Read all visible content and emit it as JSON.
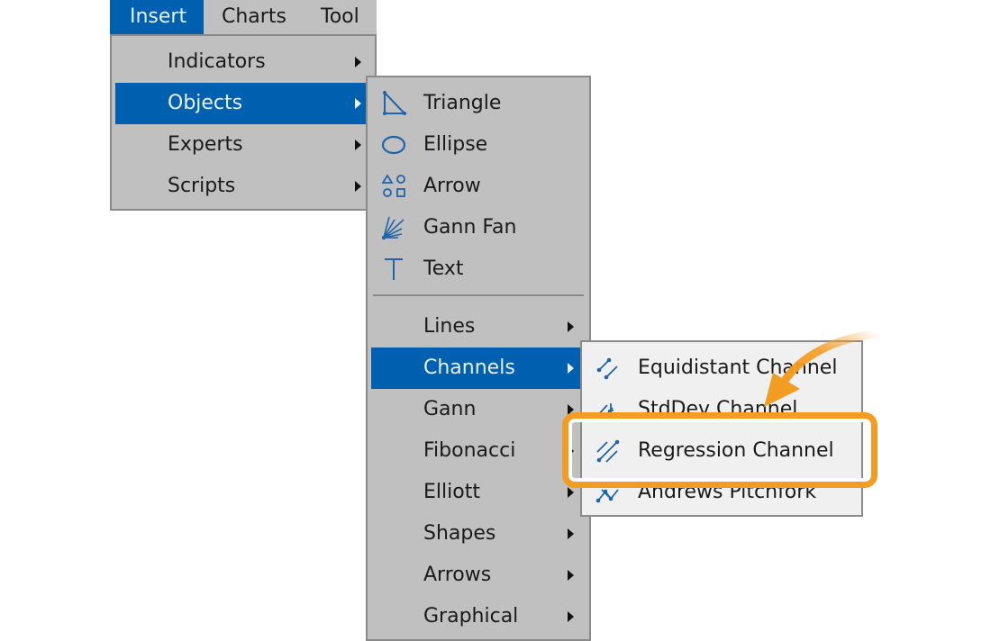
{
  "menubar": {
    "items": [
      {
        "label": "Insert",
        "active": true
      },
      {
        "label": "Charts",
        "active": false
      },
      {
        "label": "Tool",
        "active": false
      }
    ]
  },
  "insert_menu": {
    "items": [
      {
        "label": "Indicators",
        "submenu": true,
        "selected": false
      },
      {
        "label": "Objects",
        "submenu": true,
        "selected": true
      },
      {
        "label": "Experts",
        "submenu": true,
        "selected": false
      },
      {
        "label": "Scripts",
        "submenu": true,
        "selected": false
      }
    ]
  },
  "objects_menu": {
    "shapes": [
      {
        "label": "Triangle",
        "icon": "triangle-icon"
      },
      {
        "label": "Ellipse",
        "icon": "ellipse-icon"
      },
      {
        "label": "Arrow",
        "icon": "arrow-shapes-icon"
      },
      {
        "label": "Gann Fan",
        "icon": "gann-fan-icon"
      },
      {
        "label": "Text",
        "icon": "text-icon"
      }
    ],
    "groups": [
      {
        "label": "Lines",
        "submenu": true,
        "selected": false
      },
      {
        "label": "Channels",
        "submenu": true,
        "selected": true
      },
      {
        "label": "Gann",
        "submenu": true,
        "selected": false
      },
      {
        "label": "Fibonacci",
        "submenu": true,
        "selected": false
      },
      {
        "label": "Elliott",
        "submenu": true,
        "selected": false
      },
      {
        "label": "Shapes",
        "submenu": true,
        "selected": false
      },
      {
        "label": "Arrows",
        "submenu": true,
        "selected": false
      },
      {
        "label": "Graphical",
        "submenu": true,
        "selected": false
      }
    ]
  },
  "channels_menu": {
    "items": [
      {
        "label": "Equidistant Channel",
        "icon": "equidistant-channel-icon"
      },
      {
        "label": "StdDev Channel",
        "icon": "stddev-channel-icon"
      },
      {
        "label": "Regression Channel",
        "icon": "regression-channel-icon",
        "highlighted": true
      },
      {
        "label": "Andrews Pitchfork",
        "icon": "andrews-pitchfork-icon"
      }
    ]
  },
  "annotation": {
    "highlight_color": "#f39c23",
    "target": "Regression Channel"
  },
  "colors": {
    "selection": "#0060b0",
    "menu_bg": "#c0c0c0",
    "submenu_bg": "#f0f0f0",
    "icon": "#1f64a8"
  }
}
